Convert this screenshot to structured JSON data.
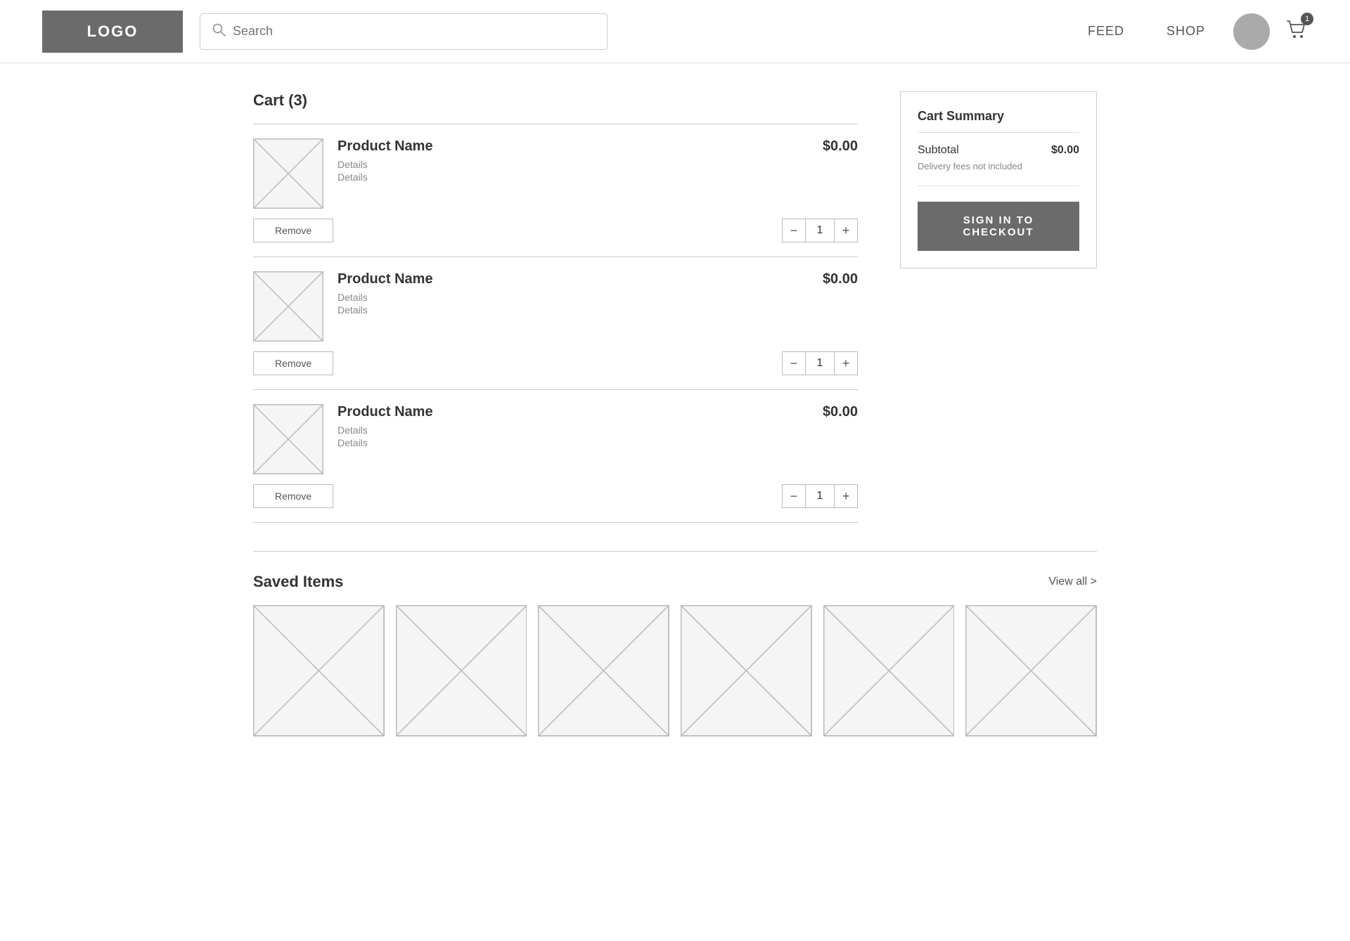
{
  "header": {
    "logo_label": "LOGO",
    "search_placeholder": "Search",
    "nav": [
      {
        "label": "FEED",
        "id": "feed"
      },
      {
        "label": "SHOP",
        "id": "shop"
      }
    ],
    "cart_badge": "1"
  },
  "cart": {
    "title": "Cart (3)",
    "items": [
      {
        "id": "item-1",
        "name": "Product Name",
        "detail1": "Details",
        "detail2": "Details",
        "price": "$0.00",
        "qty": "1",
        "remove_label": "Remove"
      },
      {
        "id": "item-2",
        "name": "Product Name",
        "detail1": "Details",
        "detail2": "Details",
        "price": "$0.00",
        "qty": "1",
        "remove_label": "Remove"
      },
      {
        "id": "item-3",
        "name": "Product Name",
        "detail1": "Details",
        "detail2": "Details",
        "price": "$0.00",
        "qty": "1",
        "remove_label": "Remove"
      }
    ]
  },
  "summary": {
    "title": "Cart Summary",
    "subtotal_label": "Subtotal",
    "subtotal_value": "$0.00",
    "delivery_note": "Delivery fees not included",
    "checkout_label": "SIGN IN TO CHECKOUT"
  },
  "saved": {
    "title": "Saved Items",
    "view_all_label": "View  all  >",
    "items_count": 6
  },
  "icons": {
    "search": "&#9906;",
    "cart": "&#128722;"
  }
}
